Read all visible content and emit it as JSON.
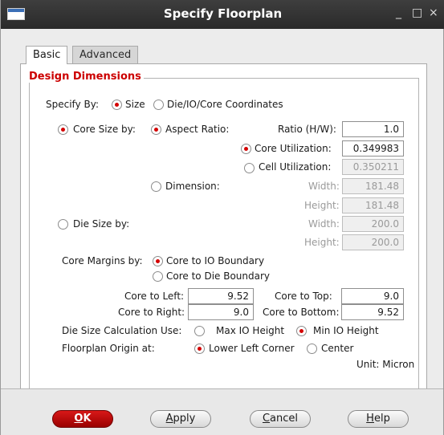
{
  "window": {
    "title": "Specify Floorplan",
    "minimize_glyph": "_",
    "maximize_glyph": "□",
    "close_glyph": "×"
  },
  "tabs": [
    {
      "label": "Basic",
      "active": true
    },
    {
      "label": "Advanced",
      "active": false
    }
  ],
  "group": {
    "title": "Design Dimensions"
  },
  "specify_by": {
    "label": "Specify By:",
    "options": [
      {
        "label": "Size",
        "selected": true
      },
      {
        "label": "Die/IO/Core Coordinates",
        "selected": false
      }
    ]
  },
  "core_size": {
    "label": "Core Size by:",
    "selected": true,
    "aspect_ratio": {
      "label": "Aspect Ratio:",
      "selected": true
    },
    "ratio": {
      "label": "Ratio (H/W):",
      "value": "1.0"
    },
    "core_utilization": {
      "label": "Core Utilization:",
      "value": "0.349983",
      "selected": true
    },
    "cell_utilization": {
      "label": "Cell Utilization:",
      "value": "0.350211",
      "selected": false
    },
    "dimension": {
      "label": "Dimension:",
      "selected": false
    },
    "width": {
      "label": "Width:",
      "value": "181.48"
    },
    "height": {
      "label": "Height:",
      "value": "181.48"
    }
  },
  "die_size": {
    "label": "Die Size by:",
    "selected": false,
    "width": {
      "label": "Width:",
      "value": "200.0"
    },
    "height": {
      "label": "Height:",
      "value": "200.0"
    }
  },
  "core_margins": {
    "label": "Core Margins by:",
    "options": [
      {
        "label": "Core to IO Boundary",
        "selected": true
      },
      {
        "label": "Core to Die Boundary",
        "selected": false
      }
    ],
    "left": {
      "label": "Core to Left:",
      "value": "9.52"
    },
    "top": {
      "label": "Core to Top:",
      "value": "9.0"
    },
    "right": {
      "label": "Core to Right:",
      "value": "9.0"
    },
    "bottom": {
      "label": "Core to Bottom:",
      "value": "9.52"
    }
  },
  "die_calc": {
    "label": "Die Size Calculation Use:",
    "options": [
      {
        "label": "Max IO Height",
        "selected": false
      },
      {
        "label": "Min IO Height",
        "selected": true
      }
    ]
  },
  "origin": {
    "label": "Floorplan Origin at:",
    "options": [
      {
        "label": "Lower Left Corner",
        "selected": true
      },
      {
        "label": "Center",
        "selected": false
      }
    ]
  },
  "unit_text": "Unit: Micron",
  "buttons": {
    "ok": {
      "mnemonic": "O",
      "rest": "K"
    },
    "apply": {
      "mnemonic": "A",
      "rest": "pply"
    },
    "cancel": {
      "mnemonic": "C",
      "rest": "ancel"
    },
    "help": {
      "mnemonic": "H",
      "rest": "elp"
    }
  },
  "colors": {
    "titlebar": "#2f2f2f",
    "accent_red": "#d40000",
    "group_title": "#cc0000",
    "ok_button": "#c00000"
  }
}
